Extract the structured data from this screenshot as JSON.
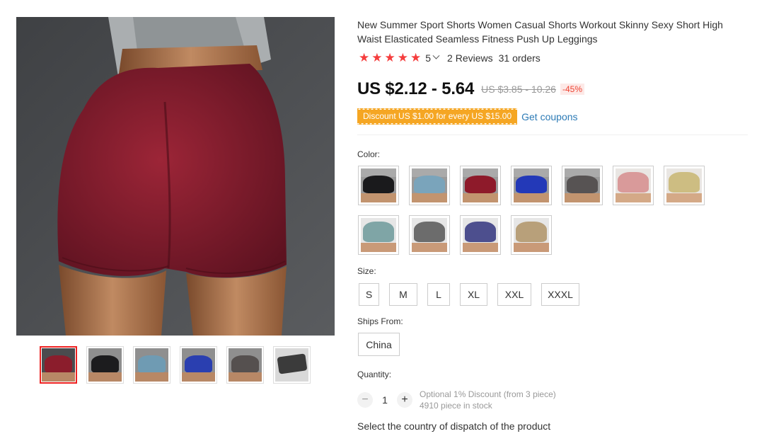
{
  "product": {
    "title": "New Summer Sport Shorts Women Casual Shorts Workout Skinny Sexy Short High Waist Elasticated Seamless Fitness Push Up Leggings",
    "rating": "5",
    "reviews": "2 Reviews",
    "orders": "31 orders",
    "price": "US $2.12 - 5.64",
    "original_price": "US $3.85 - 10.26",
    "discount": "-45%"
  },
  "coupon": {
    "tag": "Discount US $1.00 for every US $15.00",
    "link": "Get coupons"
  },
  "gallery": {
    "main_image": "red-shorts-photo",
    "thumbnails": [
      {
        "name": "red",
        "color": "#8b1d2c"
      },
      {
        "name": "black",
        "color": "#1c1c1e"
      },
      {
        "name": "light-blue",
        "color": "#6f9bb3"
      },
      {
        "name": "royal-blue",
        "color": "#2a3fb0"
      },
      {
        "name": "dark-grey",
        "color": "#55504f"
      },
      {
        "name": "size-chart",
        "color": "#3b3b3b"
      }
    ]
  },
  "options": {
    "color_label": "Color:",
    "colors": [
      {
        "name": "black",
        "color": "#1a1a1c"
      },
      {
        "name": "light-blue",
        "color": "#7aa4bb"
      },
      {
        "name": "red",
        "color": "#8e1a2a"
      },
      {
        "name": "royal-blue",
        "color": "#2339b8"
      },
      {
        "name": "dark-grey",
        "color": "#575353"
      },
      {
        "name": "pink",
        "color": "#d99a9a"
      },
      {
        "name": "khaki",
        "color": "#cdbd82"
      },
      {
        "name": "teal-grey",
        "color": "#7fa5a6"
      },
      {
        "name": "camo-grey",
        "color": "#6c6c6c"
      },
      {
        "name": "navy-purple",
        "color": "#4d4f8e"
      },
      {
        "name": "tan",
        "color": "#b8a07a"
      }
    ],
    "size_label": "Size:",
    "sizes": [
      "S",
      "M",
      "L",
      "XL",
      "XXL",
      "XXXL"
    ],
    "ships_label": "Ships From:",
    "ships_from": "China",
    "quantity_label": "Quantity:",
    "quantity": "1",
    "quantity_discount": "Optional 1% Discount (from 3 piece)",
    "stock": "4910 piece in stock",
    "dispatch_text": "Select the country of dispatch of the product"
  },
  "colors": {
    "accent": "#f53d3d",
    "coupon_bg": "#f5a623",
    "link": "#2d7bb6",
    "active_border": "#e22222"
  }
}
